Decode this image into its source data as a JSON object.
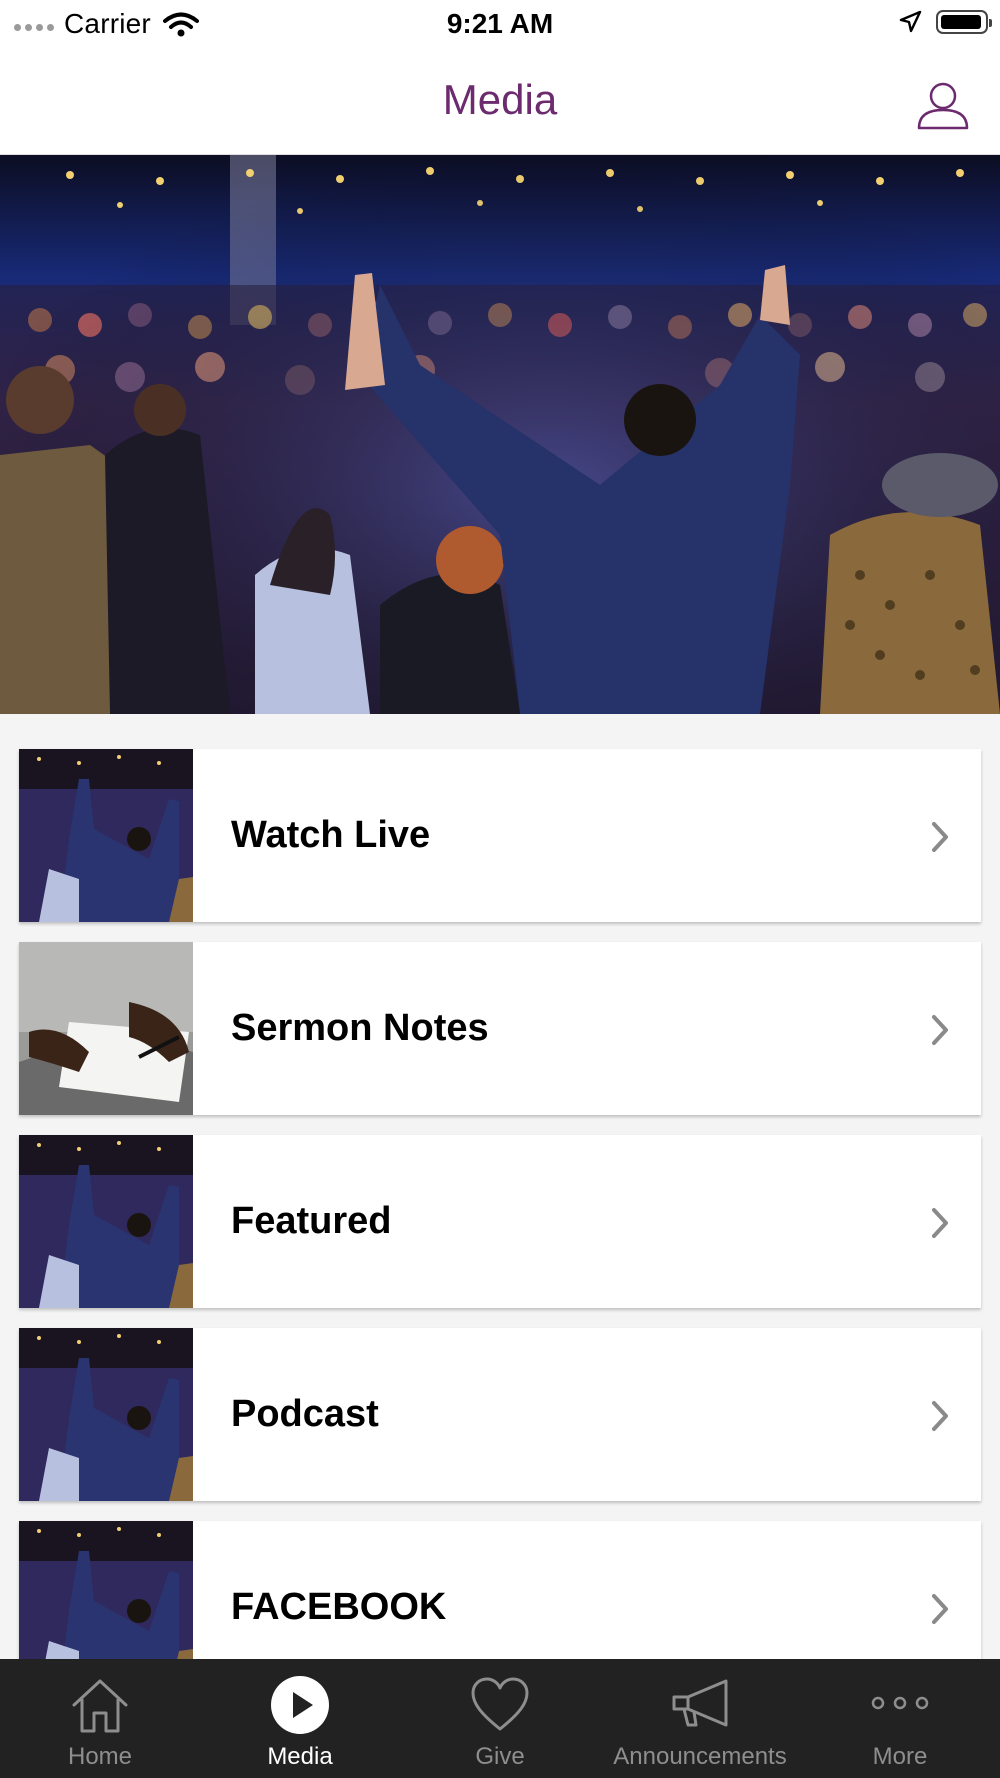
{
  "status_bar": {
    "carrier": "Carrier",
    "time": "9:21 AM"
  },
  "nav": {
    "title": "Media"
  },
  "list": {
    "items": [
      {
        "label": "Watch Live",
        "thumb": "worship-crowd"
      },
      {
        "label": "Sermon Notes",
        "thumb": "note-writing"
      },
      {
        "label": "Featured",
        "thumb": "worship-crowd"
      },
      {
        "label": "Podcast",
        "thumb": "worship-crowd"
      },
      {
        "label": "FACEBOOK",
        "thumb": "worship-crowd"
      }
    ]
  },
  "tab_bar": {
    "tabs": [
      {
        "label": "Home",
        "icon": "house-icon"
      },
      {
        "label": "Media",
        "icon": "play-icon",
        "active": true
      },
      {
        "label": "Give",
        "icon": "heart-icon"
      },
      {
        "label": "Announcements",
        "icon": "megaphone-icon"
      },
      {
        "label": "More",
        "icon": "more-dots-icon"
      }
    ]
  },
  "colors": {
    "accent": "#6b2b6e",
    "tab_bar_bg": "#222222",
    "list_bg": "#f4f4f4"
  }
}
